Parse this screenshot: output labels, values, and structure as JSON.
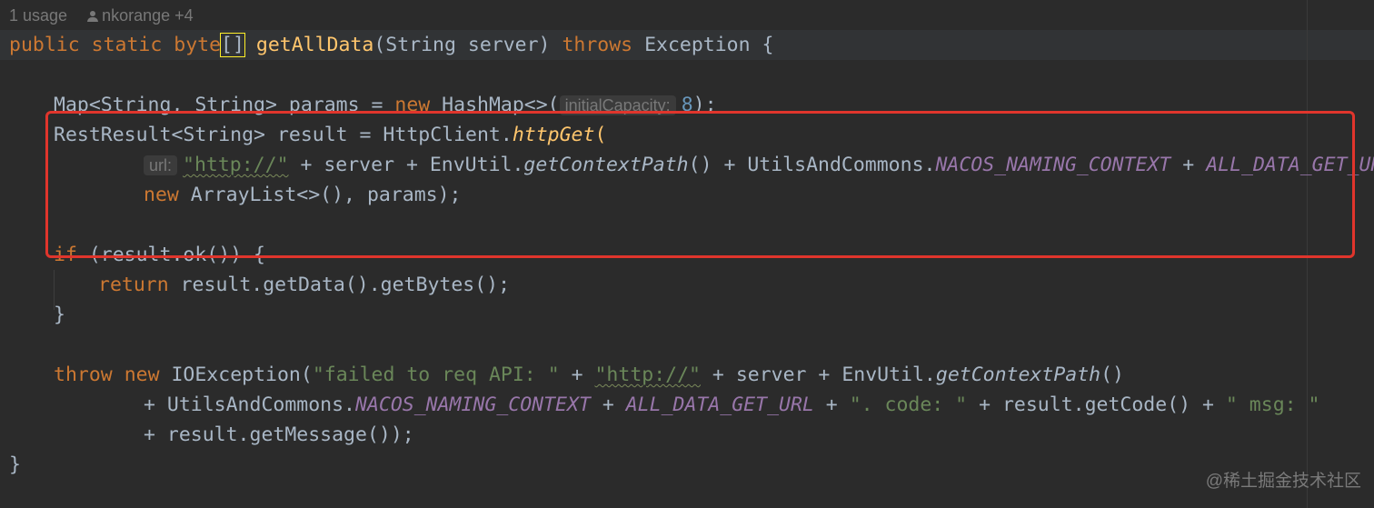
{
  "inlay_hints": {
    "usages": "1 usage",
    "author": "nkorange +4",
    "initial_capacity": "initialCapacity:",
    "url": "url:"
  },
  "code": {
    "kw_public": "public",
    "kw_static": "static",
    "type_byte": "byte",
    "brackets": "[]",
    "method_name": "getAllData",
    "params": "(String server)",
    "kw_throws": "throws",
    "exception_type": "Exception {",
    "map_decl": "Map<String, String> params = ",
    "kw_new": "new",
    "hashmap": " HashMap<>(",
    "capacity_value": "8",
    "close_paren_semi": ");",
    "restresult_decl": "RestResult<String> result = HttpClient.",
    "http_get": "httpGet",
    "open_paren": "(",
    "str_http": "\"http://\"",
    "plus_server": " + server + EnvUtil.",
    "get_context_path": "getContextPath",
    "call_plus_utils": "() + UtilsAndCommons.",
    "nacos_naming_context": "NACOS_NAMING_CONTEXT",
    "plus": " + ",
    "all_data_get_url": "ALL_DATA_GET_URL",
    "trailing_comma": ",",
    "arraylist": " ArrayList<>(), params);",
    "kw_if": "if",
    "if_cond": " (result.ok()) {",
    "kw_return": "return",
    "return_expr": " result.getData().getBytes();",
    "close_brace": "}",
    "kw_throw": "throw",
    "ioexception": " IOException(",
    "str_failed": "\"failed to req API: \"",
    "throw_mid": " + server + EnvUtil.",
    "throw_tail": "()",
    "line2_prefix": "+ UtilsAndCommons.",
    "str_code": "\". code: \"",
    "get_code": " + result.getCode() + ",
    "str_msg": "\" msg: \"",
    "line3": "+ result.getMessage());",
    "final_brace": "}"
  },
  "watermark": "@稀土掘金技术社区",
  "colors": {
    "background": "#2b2b2b",
    "keyword": "#cc7832",
    "function": "#ffc66d",
    "string": "#6a8759",
    "static_field": "#9876aa",
    "number": "#6897bb",
    "highlight_box": "#e0352c"
  }
}
